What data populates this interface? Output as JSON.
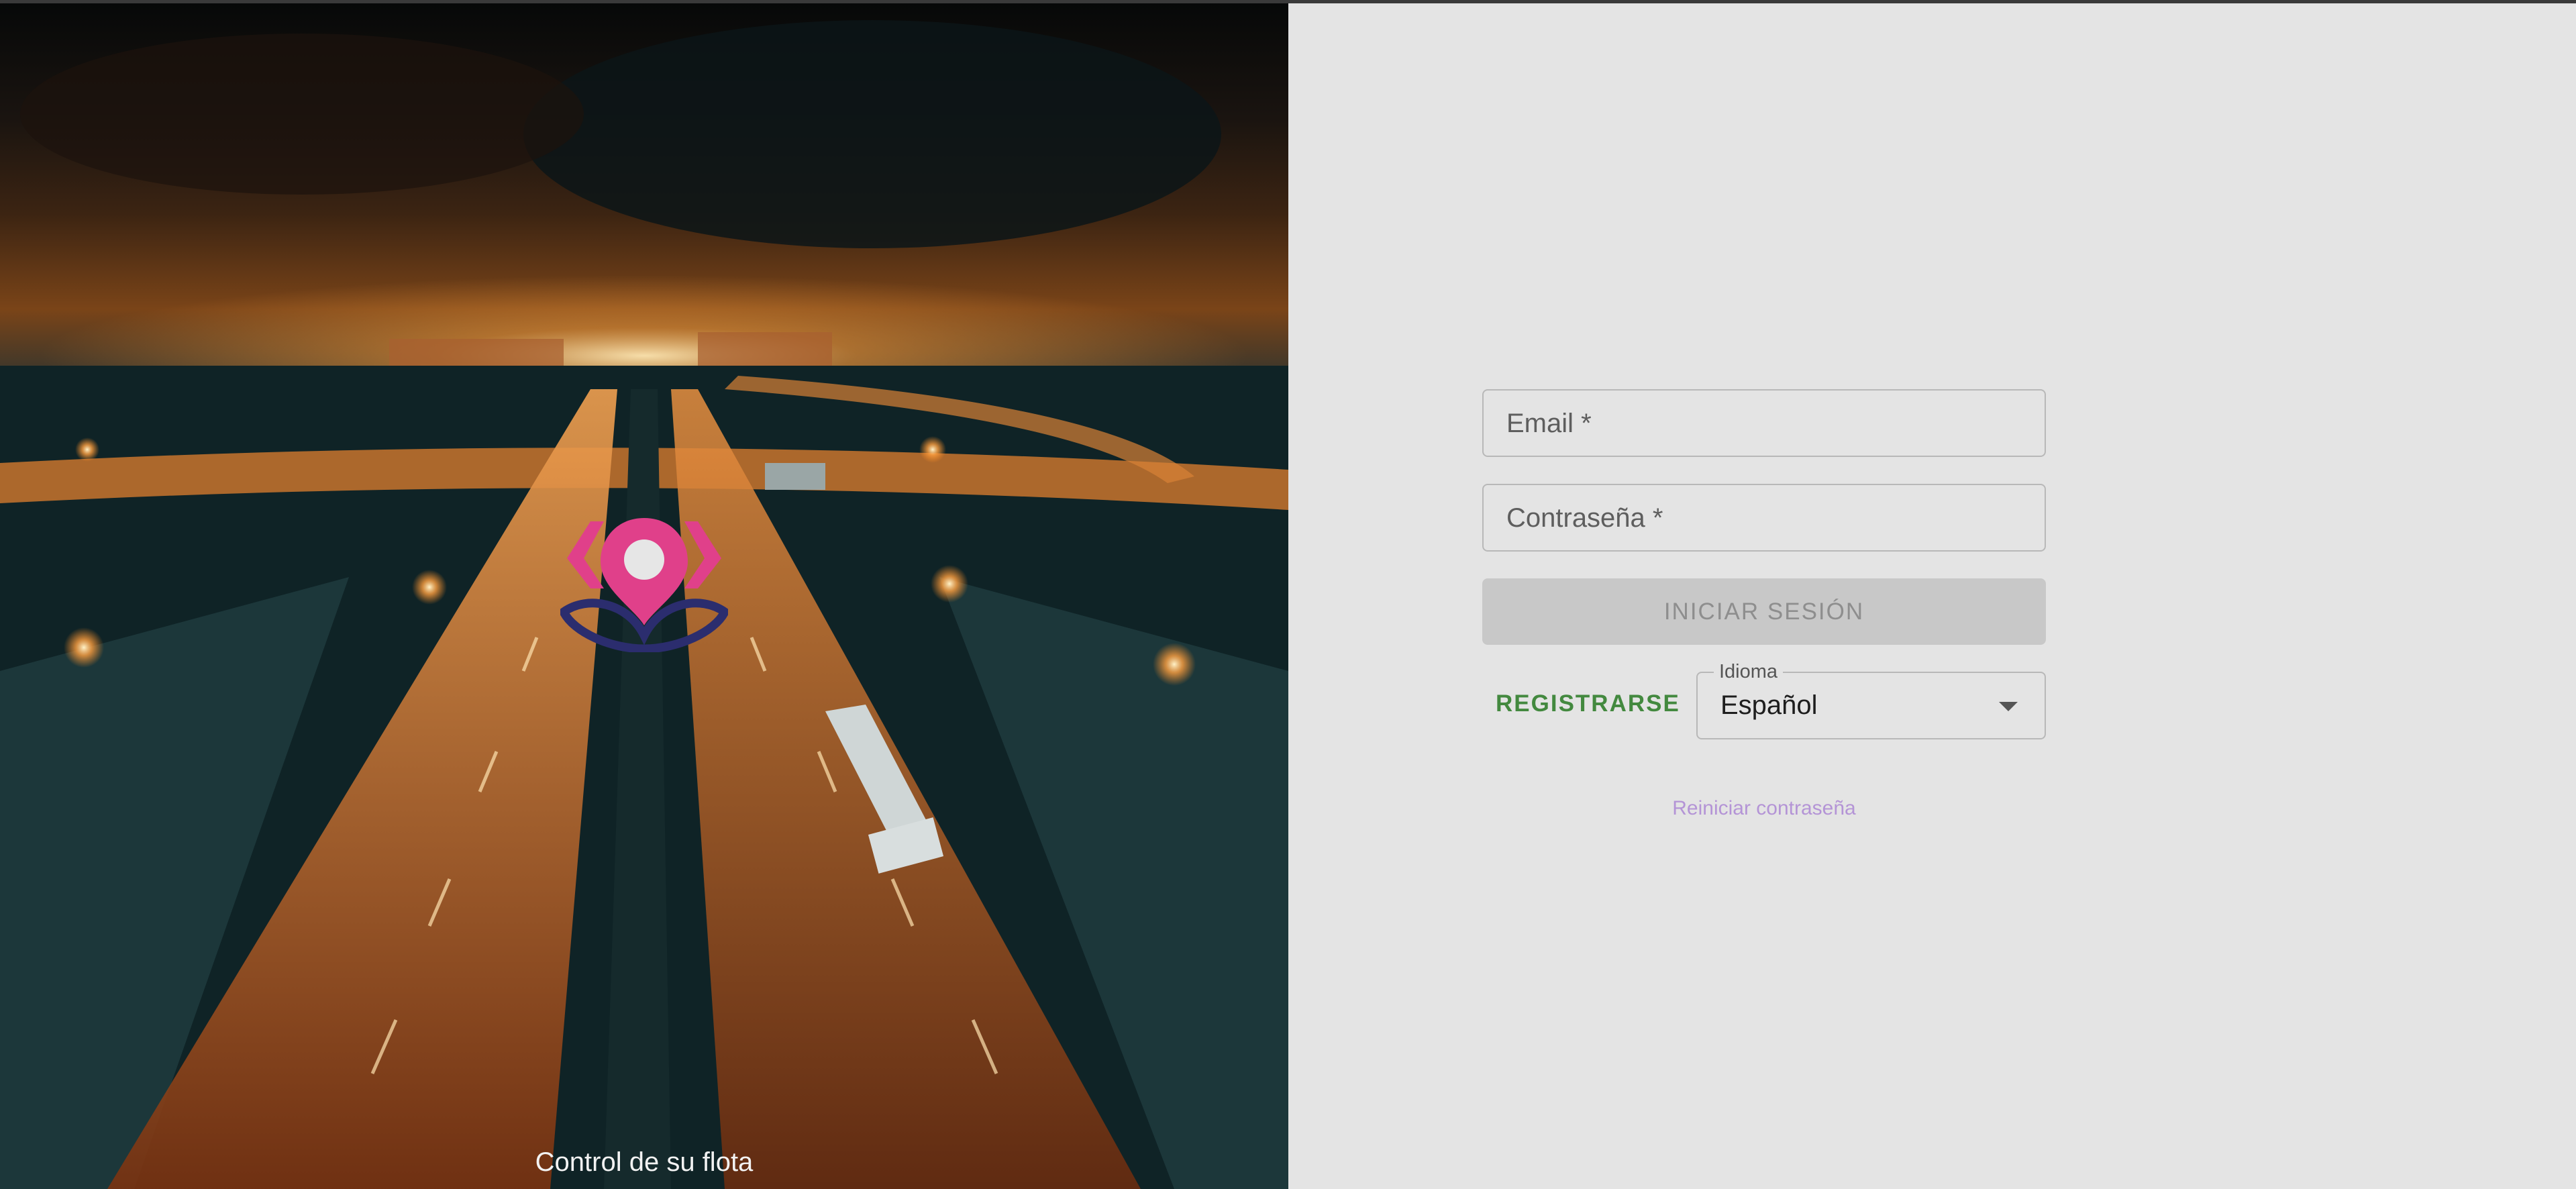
{
  "hero": {
    "caption": "Control de su flota",
    "logo_icon": "location-pin-lotus-logo"
  },
  "login_form": {
    "email_placeholder": "Email *",
    "password_placeholder": "Contraseña *",
    "login_button_label": "INICIAR SESIÓN",
    "register_label": "REGISTRARSE",
    "language": {
      "legend": "Idioma",
      "selected": "Español"
    },
    "reset_password_link": "Reiniciar contraseña"
  },
  "colors": {
    "register": "#43893f",
    "reset_link": "#b494d6",
    "logo_pink": "#e0408a",
    "logo_navy": "#2b2d6e"
  }
}
